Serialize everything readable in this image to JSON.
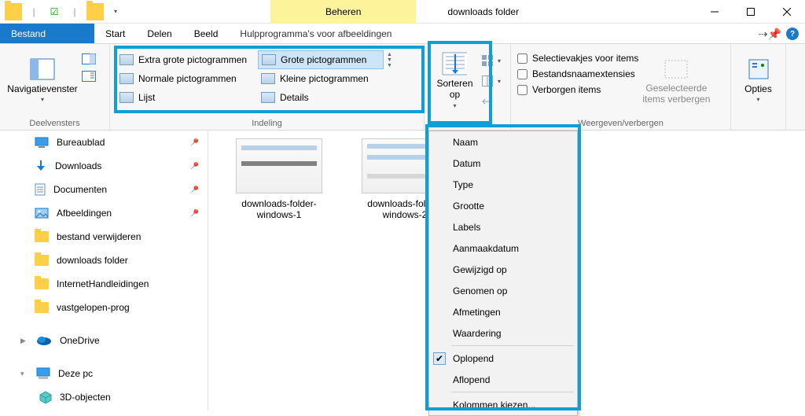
{
  "titlebar": {
    "context_tab": "Beheren",
    "window_title": "downloads folder"
  },
  "tabs": {
    "file": "Bestand",
    "start": "Start",
    "share": "Delen",
    "view": "Beeld",
    "picture_tools": "Hulpprogramma's voor afbeeldingen"
  },
  "ribbon": {
    "panes": {
      "nav_pane": "Navigatievenster",
      "group_label": "Deelvensters"
    },
    "layout": {
      "extra_large": "Extra grote pictogrammen",
      "large": "Grote pictogrammen",
      "normal": "Normale pictogrammen",
      "small": "Kleine pictogrammen",
      "list": "Lijst",
      "details": "Details",
      "group_label": "Indeling"
    },
    "sort": {
      "label": "Sorteren op"
    },
    "showhide": {
      "checkboxes": "Selectievakjes voor items",
      "extensions": "Bestandsnaamextensies",
      "hidden": "Verborgen items",
      "hide_selected": "Geselecteerde items verbergen",
      "group_label": "Weergeven/verbergen"
    },
    "options": "Opties"
  },
  "nav": {
    "desktop": "Bureaublad",
    "downloads": "Downloads",
    "documents": "Documenten",
    "pictures": "Afbeeldingen",
    "f1": "bestand verwijderen",
    "f2": "downloads folder",
    "f3": "InternetHandleidingen",
    "f4": "vastgelopen-prog",
    "onedrive": "OneDrive",
    "thispc": "Deze pc",
    "objects3d": "3D-objecten"
  },
  "files": {
    "a": "downloads-folder-windows-1",
    "b": "downloads-folder-windows-2"
  },
  "sortmenu": {
    "naam": "Naam",
    "datum": "Datum",
    "type": "Type",
    "grootte": "Grootte",
    "labels": "Labels",
    "aanmaak": "Aanmaakdatum",
    "gewijzigd": "Gewijzigd op",
    "genomen": "Genomen op",
    "afmetingen": "Afmetingen",
    "waardering": "Waardering",
    "asc": "Oplopend",
    "desc": "Aflopend",
    "columns": "Kolommen kiezen..."
  }
}
